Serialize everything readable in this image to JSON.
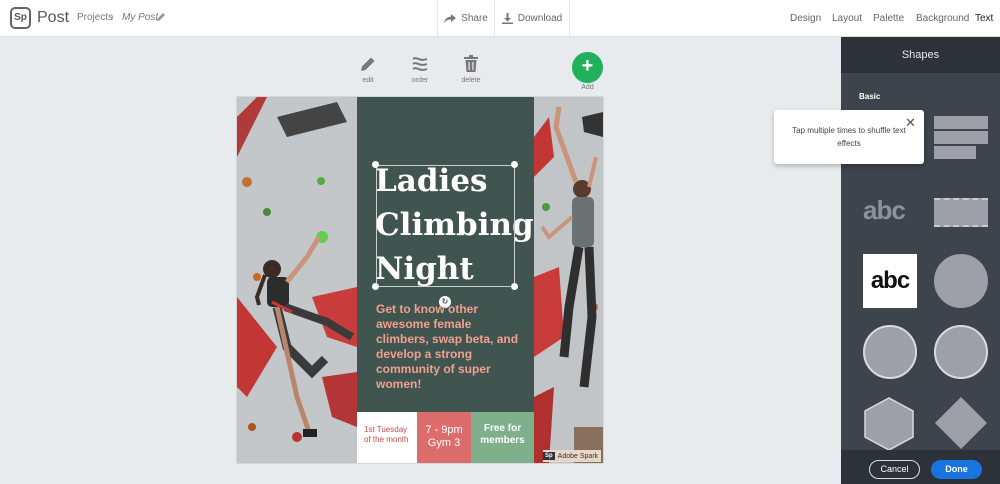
{
  "app": {
    "logo_text": "Sp",
    "name": "Post"
  },
  "breadcrumb": {
    "projects": "Projects",
    "separator": "›",
    "current": "My Post"
  },
  "toolbar": {
    "share_label": "Share",
    "download_label": "Download"
  },
  "nav": {
    "items": [
      {
        "label": "Design",
        "active": false
      },
      {
        "label": "Layout",
        "active": false
      },
      {
        "label": "Palette",
        "active": false
      },
      {
        "label": "Background",
        "active": false
      },
      {
        "label": "Text",
        "active": true
      }
    ]
  },
  "tools": {
    "edit": "edit",
    "order": "order",
    "delete": "delete",
    "add": "Add"
  },
  "canvas": {
    "headline": "Ladies Climbing Night",
    "body": "Get to know other awesome female climbers, swap beta, and develop a strong community of super women!",
    "day": "1st Tuesday of the month",
    "time": "7 - 9pm Gym 3",
    "members": "Free for members",
    "badge_logo": "Sp",
    "badge_text": "Adobe Spark",
    "colors": {
      "panel": "#405450",
      "body_text": "#f0a08e",
      "time_cell": "#dc6d6b",
      "members_cell": "#7fb08c"
    }
  },
  "panel": {
    "title": "Shapes",
    "section": "Basic",
    "abc_outline": "abc",
    "abc_box": "abc",
    "cancel": "Cancel",
    "done": "Done"
  },
  "tooltip": {
    "text": "Tap multiple times to shuffle text effects",
    "close": "✕"
  },
  "icons": [
    "pencil-icon",
    "share-icon",
    "download-icon",
    "order-icon",
    "trash-icon",
    "plus-icon",
    "close-icon",
    "rotate-icon"
  ]
}
